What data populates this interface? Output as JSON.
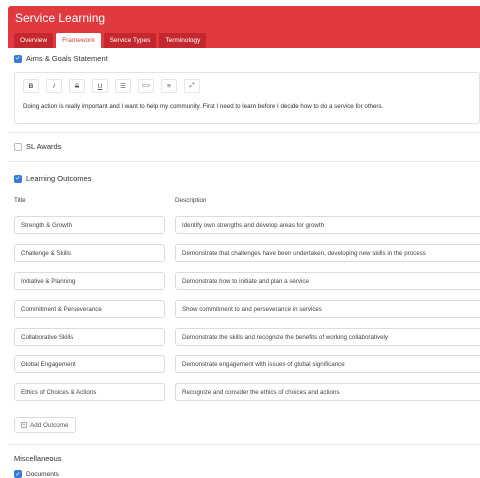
{
  "app": {
    "title": "Service Learning"
  },
  "tabs": [
    {
      "label": "Overview"
    },
    {
      "label": "Framework"
    },
    {
      "label": "Service Types"
    },
    {
      "label": "Terminology"
    }
  ],
  "aims": {
    "label": "Aims & Goals Statement",
    "checked": true,
    "toolbar": [
      {
        "icon": "bold-icon",
        "glyph": "B"
      },
      {
        "icon": "italic-icon",
        "glyph": "I"
      },
      {
        "icon": "strikethrough-icon",
        "glyph": "S"
      },
      {
        "icon": "underline-icon",
        "glyph": "U"
      },
      {
        "icon": "list-icon",
        "glyph": "☰"
      },
      {
        "icon": "link-icon",
        "glyph": "⊂⊃"
      },
      {
        "icon": "align-icon",
        "glyph": "≡"
      },
      {
        "icon": "expand-icon",
        "glyph": "⤢"
      }
    ],
    "text": "Doing action is really important and I want to help my community. First I need to learn before I decide how to do a service for others."
  },
  "awards": {
    "label": "SL Awards",
    "checked": false
  },
  "outcomes": {
    "label": "Learning Outcomes",
    "checked": true,
    "columns": {
      "title": "Title",
      "description": "Description"
    },
    "rows": [
      {
        "title": "Strength & Growth",
        "description": "Identify own strengths and develop areas for growth"
      },
      {
        "title": "Challenge & Skills",
        "description": "Demonstrate that challenges have been undertaken, developing new skills in the process"
      },
      {
        "title": "Initiative & Planning",
        "description": "Demonstrate how to initiate and plan a service"
      },
      {
        "title": "Commitment & Perseverance",
        "description": "Show commitment to and perseverance in services"
      },
      {
        "title": "Collaborative Skills",
        "description": "Demonstrate the skills and recognize the benefits of working collaboratively"
      },
      {
        "title": "Global Engagement",
        "description": "Demonstrate engagement with issues of global significance"
      },
      {
        "title": "Ethics of Choices & Actions",
        "description": "Recognize and consider the ethics of choices and actions"
      }
    ],
    "add_label": "Add Outcome"
  },
  "misc": {
    "heading": "Miscellaneous",
    "documents_label": "Documents",
    "documents_checked": true
  },
  "colors": {
    "brand": "#e0393e",
    "checkbox": "#3a7bd5"
  }
}
